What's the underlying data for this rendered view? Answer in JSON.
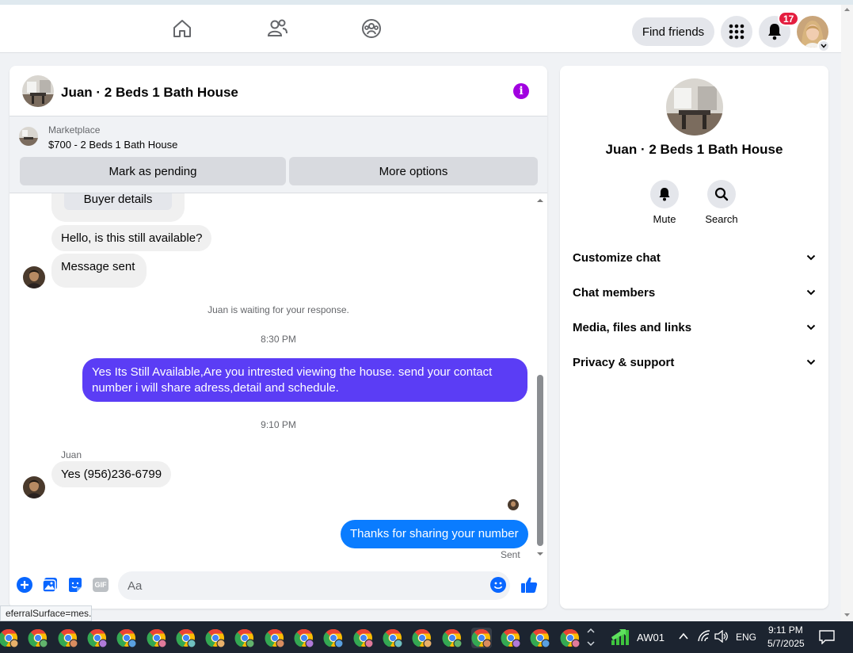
{
  "nav": {
    "find_friends": "Find friends",
    "notification_count": "17"
  },
  "chat": {
    "title": "Juan · 2 Beds 1 Bath House",
    "marketplace_label": "Marketplace",
    "listing": "$700 - 2 Beds 1 Bath House",
    "mark_pending": "Mark as pending",
    "more_options": "More options",
    "buyer_details": "Buyer details",
    "msg1": "Hello, is this still available?",
    "msg2": "Message sent",
    "waiting": "Juan is waiting for your response.",
    "time1": "8:30 PM",
    "out1": "Yes Its Still Available,Are you intrested viewing the house. send your contact number i will share adress,detail and schedule.",
    "time2": "9:10 PM",
    "sender_name": "Juan",
    "msg3": "Yes (956)236-6799",
    "out2": "Thanks for sharing your number",
    "sent_status": "Sent",
    "input_placeholder": "Aa",
    "gif_label": "GIF"
  },
  "info": {
    "title": "Juan · 2 Beds 1 Bath House",
    "mute": "Mute",
    "search": "Search",
    "customize": "Customize chat",
    "members": "Chat members",
    "media": "Media, files and links",
    "privacy": "Privacy & support"
  },
  "status_url": "eferralSurface=mes...",
  "taskbar": {
    "network_name": "AW01",
    "language": "ENG",
    "time": "9:11 PM",
    "date": "5/7/2025"
  },
  "colors": {
    "outgoing_purple": "#5b3df5",
    "outgoing_blue": "#0a7cff",
    "accent": "#0866ff",
    "info_purple": "#a100e0",
    "badge_red": "#e41e3f"
  }
}
